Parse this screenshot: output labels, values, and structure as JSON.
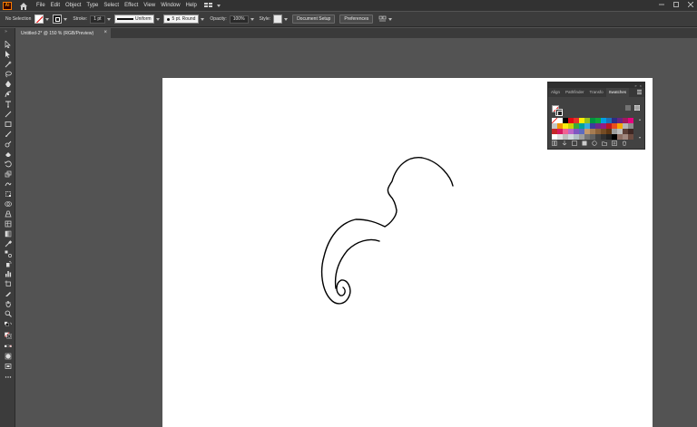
{
  "app": {
    "logo_text": "Ai"
  },
  "menu": {
    "items": [
      "File",
      "Edit",
      "Object",
      "Type",
      "Select",
      "Effect",
      "View",
      "Window",
      "Help"
    ]
  },
  "control_bar": {
    "selection_label": "No Selection",
    "stroke_label": "Stroke:",
    "stroke_weight": "1 pt",
    "profile_label": "Uniform",
    "brush_label": "5 pt. Round",
    "opacity_label": "Opacity:",
    "opacity_value": "100%",
    "style_label": "Style:",
    "document_setup_label": "Document Setup",
    "preferences_label": "Preferences"
  },
  "tab": {
    "title": "Untitled-2* @ 150 % (RGB/Preview)",
    "close": "×"
  },
  "panel": {
    "tabs": [
      "Align",
      "Pathfinder",
      "Transfo",
      "Swatches"
    ],
    "active_tab": "Swatches",
    "collapse_glyph": "»",
    "close_glyph": "×"
  },
  "swatch_colors": [
    "#ffffff",
    "#ffffff",
    "#000000",
    "#e30613",
    "#e6332a",
    "#ffed00",
    "#95c11f",
    "#009640",
    "#13a538",
    "#009fe3",
    "#1d71b8",
    "#2d2e83",
    "#662483",
    "#a3195b",
    "#e6007e",
    "#c6c6c6",
    "#f39200",
    "#fcea10",
    "#c8d400",
    "#3aaa35",
    "#00a19a",
    "#36a9e1",
    "#3c3c9e",
    "#6e2a8c",
    "#951b81",
    "#be1622",
    "#e94e1b",
    "#f7a600",
    "#b5b5b5",
    "#8c8c8c",
    "#c62828",
    "#d81b60",
    "#f06292",
    "#ba68c8",
    "#7e57c2",
    "#5c6bc0",
    "#c49a6c",
    "#a67c52",
    "#8c6239",
    "#754c24",
    "#603813",
    "#9e9e9e",
    "#bdbdbd",
    "#5d4037",
    "#3e2723",
    "#ffffff",
    "#e0e0e0",
    "#bdbdbd",
    "#cfd8dc",
    "#b0bec5",
    "#9e9e9e",
    "#757575",
    "#616161",
    "#424242",
    "#303030",
    "#212121",
    "#000000",
    "#8d6e63",
    "#a1887f",
    "#6d4c41"
  ],
  "icons": {
    "home": "home-icon",
    "workspace": "workspace-switcher-icon"
  }
}
